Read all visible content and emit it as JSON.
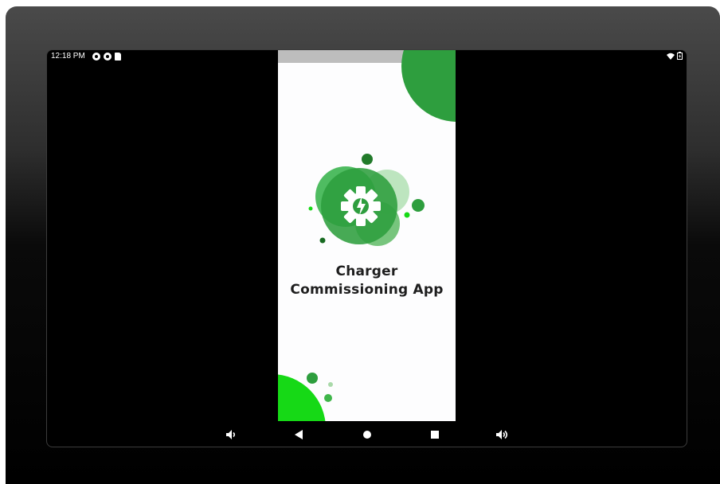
{
  "status_bar": {
    "time": "12:18 PM",
    "left_icons": [
      "status-circle-icon",
      "status-circle-icon",
      "sd-card-icon"
    ],
    "right_icons": [
      "wifi-icon",
      "battery-icon"
    ]
  },
  "app": {
    "title_line1": "Charger",
    "title_line2": "Commissioning App",
    "logo_icon": "gear-lightning-icon",
    "accent_color": "#2e9e3e",
    "light_green": "#16d916"
  },
  "nav_bar": {
    "buttons": [
      "volume-down-icon",
      "back-icon",
      "home-icon",
      "recents-icon",
      "volume-up-icon"
    ]
  }
}
